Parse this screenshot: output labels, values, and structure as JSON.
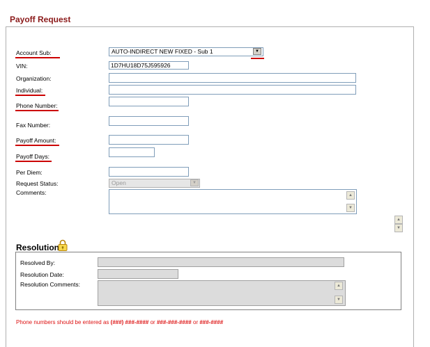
{
  "page_title": "Payoff Request",
  "form": {
    "account_sub": {
      "label": "Account Sub:",
      "value": "AUTO-INDIRECT NEW FIXED - Sub 1"
    },
    "vin": {
      "label": "VIN:",
      "value": "1D7HU18D75J595926"
    },
    "organization": {
      "label": "Organization:",
      "value": ""
    },
    "individual": {
      "label": "Individual:",
      "value": ""
    },
    "phone_number": {
      "label": "Phone Number:",
      "value": ""
    },
    "fax_number": {
      "label": "Fax Number:",
      "value": ""
    },
    "payoff_amount": {
      "label": "Payoff Amount:",
      "value": ""
    },
    "payoff_days": {
      "label": "Payoff Days:",
      "value": ""
    },
    "per_diem": {
      "label": "Per Diem:",
      "value": ""
    },
    "request_status": {
      "label": "Request Status:",
      "value": "Open"
    },
    "comments": {
      "label": "Comments:",
      "value": ""
    }
  },
  "resolution": {
    "title": "Resolution:",
    "resolved_by": {
      "label": "Resolved By:",
      "value": ""
    },
    "resolution_date": {
      "label": "Resolution Date:",
      "value": ""
    },
    "resolution_comments": {
      "label": "Resolution Comments:",
      "value": ""
    }
  },
  "note": {
    "prefix": "Phone numbers should be entered as ",
    "f1": "(###) ###-####",
    "sep1": " or ",
    "f2": "###-###-####",
    "sep2": " or ",
    "f3": "###-####"
  },
  "colors": {
    "title": "#8b1a1a",
    "required_underline": "#cc0000",
    "note": "#dd1111"
  },
  "icons": {
    "dropdown": "▼",
    "scroll_up": "▲",
    "scroll_down": "▼",
    "lock": "lock-icon"
  }
}
